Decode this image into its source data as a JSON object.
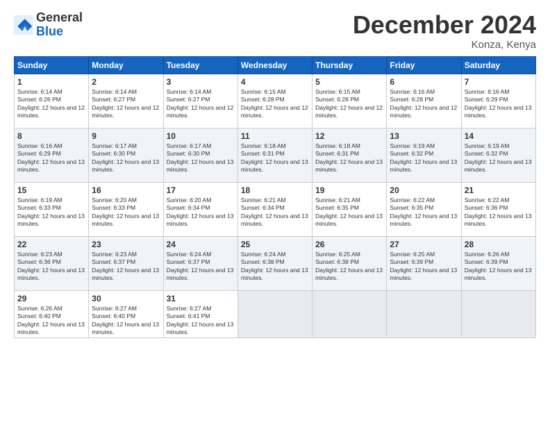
{
  "logo": {
    "general": "General",
    "blue": "Blue"
  },
  "header": {
    "month": "December 2024",
    "location": "Konza, Kenya"
  },
  "weekdays": [
    "Sunday",
    "Monday",
    "Tuesday",
    "Wednesday",
    "Thursday",
    "Friday",
    "Saturday"
  ],
  "weeks": [
    [
      {
        "day": 1,
        "sunrise": "6:14 AM",
        "sunset": "6:26 PM",
        "daylight": "12 hours and 12 minutes."
      },
      {
        "day": 2,
        "sunrise": "6:14 AM",
        "sunset": "6:27 PM",
        "daylight": "12 hours and 12 minutes."
      },
      {
        "day": 3,
        "sunrise": "6:14 AM",
        "sunset": "6:27 PM",
        "daylight": "12 hours and 12 minutes."
      },
      {
        "day": 4,
        "sunrise": "6:15 AM",
        "sunset": "6:28 PM",
        "daylight": "12 hours and 12 minutes."
      },
      {
        "day": 5,
        "sunrise": "6:15 AM",
        "sunset": "6:28 PM",
        "daylight": "12 hours and 12 minutes."
      },
      {
        "day": 6,
        "sunrise": "6:16 AM",
        "sunset": "6:28 PM",
        "daylight": "12 hours and 12 minutes."
      },
      {
        "day": 7,
        "sunrise": "6:16 AM",
        "sunset": "6:29 PM",
        "daylight": "12 hours and 13 minutes."
      }
    ],
    [
      {
        "day": 8,
        "sunrise": "6:16 AM",
        "sunset": "6:29 PM",
        "daylight": "12 hours and 13 minutes."
      },
      {
        "day": 9,
        "sunrise": "6:17 AM",
        "sunset": "6:30 PM",
        "daylight": "12 hours and 13 minutes."
      },
      {
        "day": 10,
        "sunrise": "6:17 AM",
        "sunset": "6:30 PM",
        "daylight": "12 hours and 13 minutes."
      },
      {
        "day": 11,
        "sunrise": "6:18 AM",
        "sunset": "6:31 PM",
        "daylight": "12 hours and 13 minutes."
      },
      {
        "day": 12,
        "sunrise": "6:18 AM",
        "sunset": "6:31 PM",
        "daylight": "12 hours and 13 minutes."
      },
      {
        "day": 13,
        "sunrise": "6:19 AM",
        "sunset": "6:32 PM",
        "daylight": "12 hours and 13 minutes."
      },
      {
        "day": 14,
        "sunrise": "6:19 AM",
        "sunset": "6:32 PM",
        "daylight": "12 hours and 13 minutes."
      }
    ],
    [
      {
        "day": 15,
        "sunrise": "6:19 AM",
        "sunset": "6:33 PM",
        "daylight": "12 hours and 13 minutes."
      },
      {
        "day": 16,
        "sunrise": "6:20 AM",
        "sunset": "6:33 PM",
        "daylight": "12 hours and 13 minutes."
      },
      {
        "day": 17,
        "sunrise": "6:20 AM",
        "sunset": "6:34 PM",
        "daylight": "12 hours and 13 minutes."
      },
      {
        "day": 18,
        "sunrise": "6:21 AM",
        "sunset": "6:34 PM",
        "daylight": "12 hours and 13 minutes."
      },
      {
        "day": 19,
        "sunrise": "6:21 AM",
        "sunset": "6:35 PM",
        "daylight": "12 hours and 13 minutes."
      },
      {
        "day": 20,
        "sunrise": "6:22 AM",
        "sunset": "6:35 PM",
        "daylight": "12 hours and 13 minutes."
      },
      {
        "day": 21,
        "sunrise": "6:22 AM",
        "sunset": "6:36 PM",
        "daylight": "12 hours and 13 minutes."
      }
    ],
    [
      {
        "day": 22,
        "sunrise": "6:23 AM",
        "sunset": "6:36 PM",
        "daylight": "12 hours and 13 minutes."
      },
      {
        "day": 23,
        "sunrise": "6:23 AM",
        "sunset": "6:37 PM",
        "daylight": "12 hours and 13 minutes."
      },
      {
        "day": 24,
        "sunrise": "6:24 AM",
        "sunset": "6:37 PM",
        "daylight": "12 hours and 13 minutes."
      },
      {
        "day": 25,
        "sunrise": "6:24 AM",
        "sunset": "6:38 PM",
        "daylight": "12 hours and 13 minutes."
      },
      {
        "day": 26,
        "sunrise": "6:25 AM",
        "sunset": "6:38 PM",
        "daylight": "12 hours and 13 minutes."
      },
      {
        "day": 27,
        "sunrise": "6:25 AM",
        "sunset": "6:39 PM",
        "daylight": "12 hours and 13 minutes."
      },
      {
        "day": 28,
        "sunrise": "6:26 AM",
        "sunset": "6:39 PM",
        "daylight": "12 hours and 13 minutes."
      }
    ],
    [
      {
        "day": 29,
        "sunrise": "6:26 AM",
        "sunset": "6:40 PM",
        "daylight": "12 hours and 13 minutes."
      },
      {
        "day": 30,
        "sunrise": "6:27 AM",
        "sunset": "6:40 PM",
        "daylight": "12 hours and 13 minutes."
      },
      {
        "day": 31,
        "sunrise": "6:27 AM",
        "sunset": "6:41 PM",
        "daylight": "12 hours and 13 minutes."
      },
      null,
      null,
      null,
      null
    ]
  ]
}
